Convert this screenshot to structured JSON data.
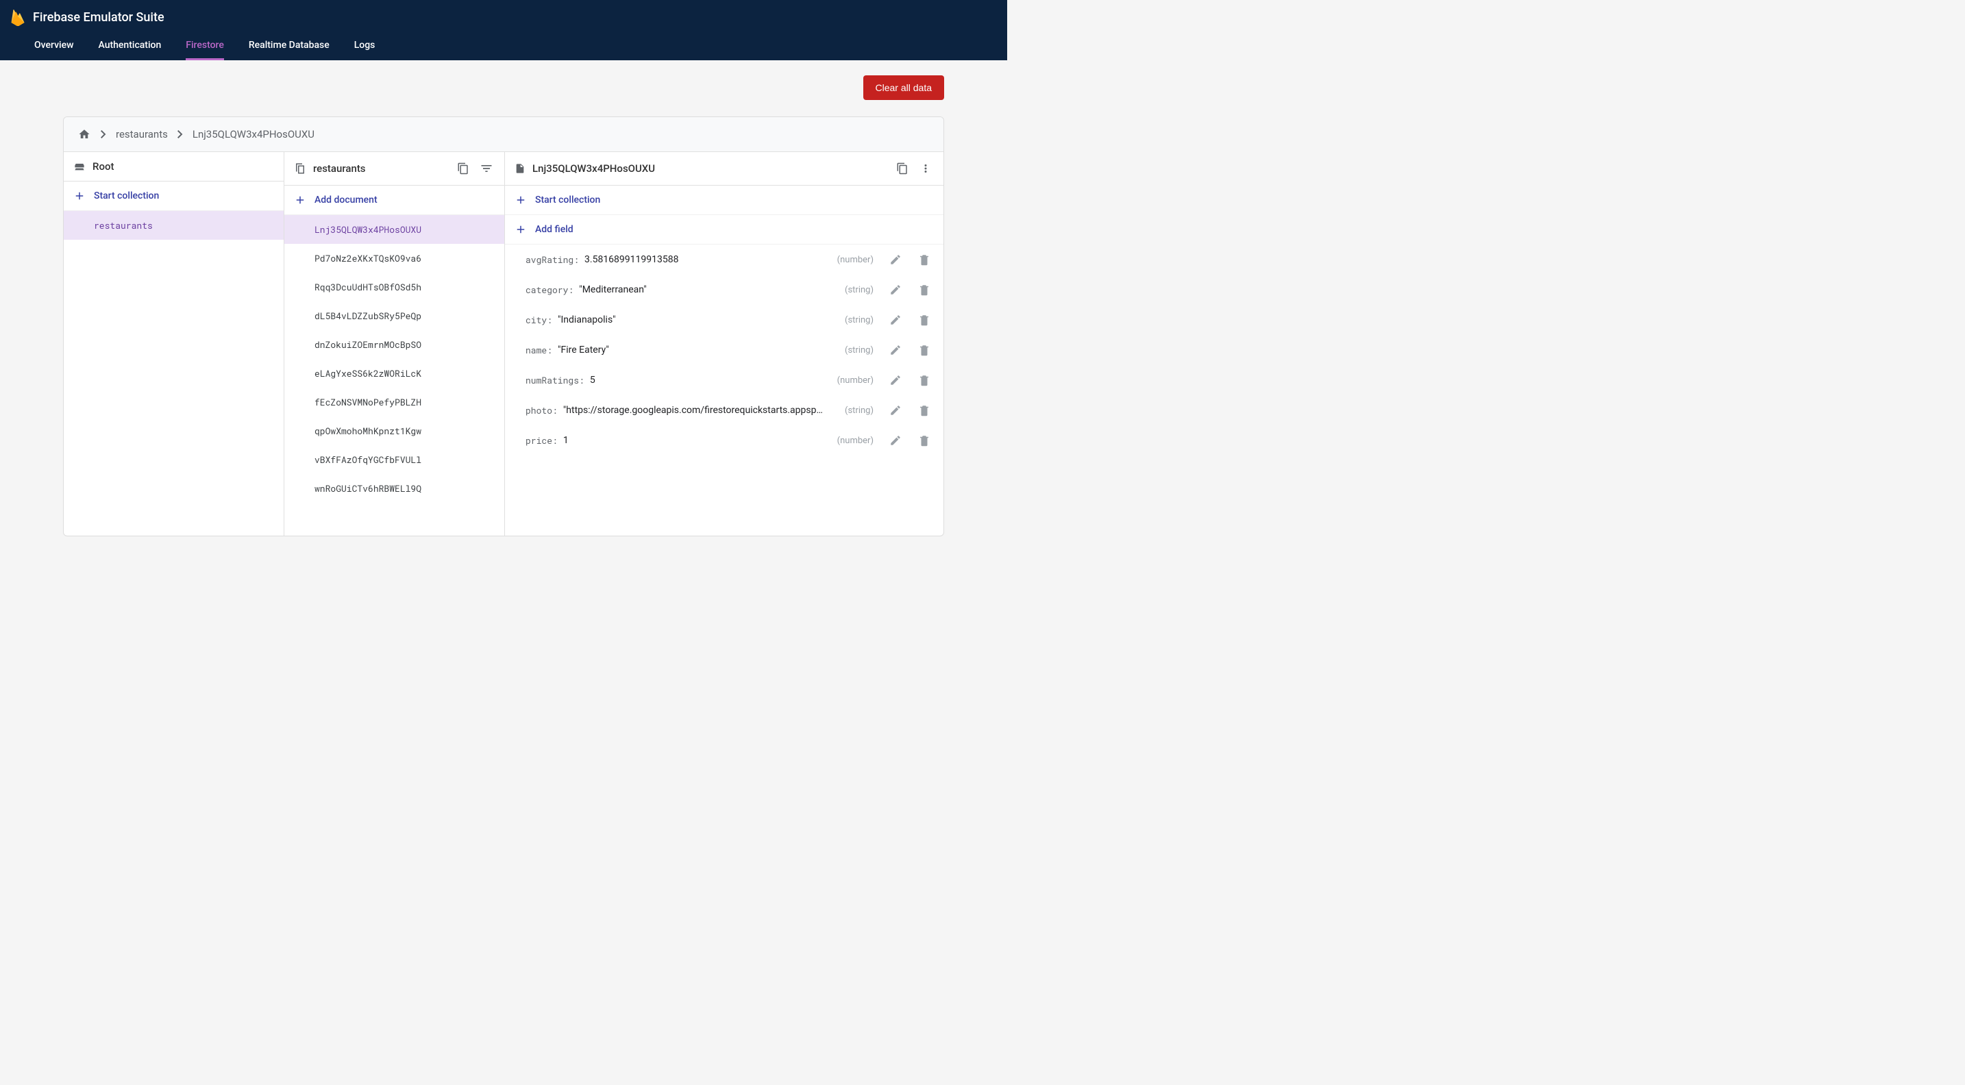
{
  "header": {
    "title": "Firebase Emulator Suite",
    "tabs": [
      "Overview",
      "Authentication",
      "Firestore",
      "Realtime Database",
      "Logs"
    ],
    "active_tab_index": 2
  },
  "actions": {
    "clear_all": "Clear all data"
  },
  "breadcrumb": {
    "crumbs": [
      "restaurants",
      "Lnj35QLQW3x4PHosOUXU"
    ]
  },
  "panel_root": {
    "title": "Root",
    "start_collection": "Start collection",
    "collections": [
      "restaurants"
    ],
    "selected_index": 0
  },
  "panel_collection": {
    "title": "restaurants",
    "add_document": "Add document",
    "documents": [
      "Lnj35QLQW3x4PHosOUXU",
      "Pd7oNz2eXKxTQsKO9va6",
      "Rqq3DcuUdHTsOBfOSd5h",
      "dL5B4vLDZZubSRy5PeQp",
      "dnZokuiZOEmrnMOcBpSO",
      "eLAgYxeSS6k2zWORiLcK",
      "fEcZoNSVMNoPefyPBLZH",
      "qpOwXmohoMhKpnzt1Kgw",
      "vBXfFAzOfqYGCfbFVULl",
      "wnRoGUiCTv6hRBWELl9Q"
    ],
    "selected_index": 0
  },
  "panel_document": {
    "title": "Lnj35QLQW3x4PHosOUXU",
    "start_collection": "Start collection",
    "add_field": "Add field",
    "fields": [
      {
        "key": "avgRating",
        "value": "3.5816899119913588",
        "type": "number",
        "is_string": false
      },
      {
        "key": "category",
        "value": "Mediterranean",
        "type": "string",
        "is_string": true
      },
      {
        "key": "city",
        "value": "Indianapolis",
        "type": "string",
        "is_string": true
      },
      {
        "key": "name",
        "value": "Fire Eatery",
        "type": "string",
        "is_string": true
      },
      {
        "key": "numRatings",
        "value": "5",
        "type": "number",
        "is_string": false
      },
      {
        "key": "photo",
        "value": "https://storage.googleapis.com/firestorequickstarts.appspot.…",
        "type": "string",
        "is_string": true
      },
      {
        "key": "price",
        "value": "1",
        "type": "number",
        "is_string": false
      }
    ]
  }
}
